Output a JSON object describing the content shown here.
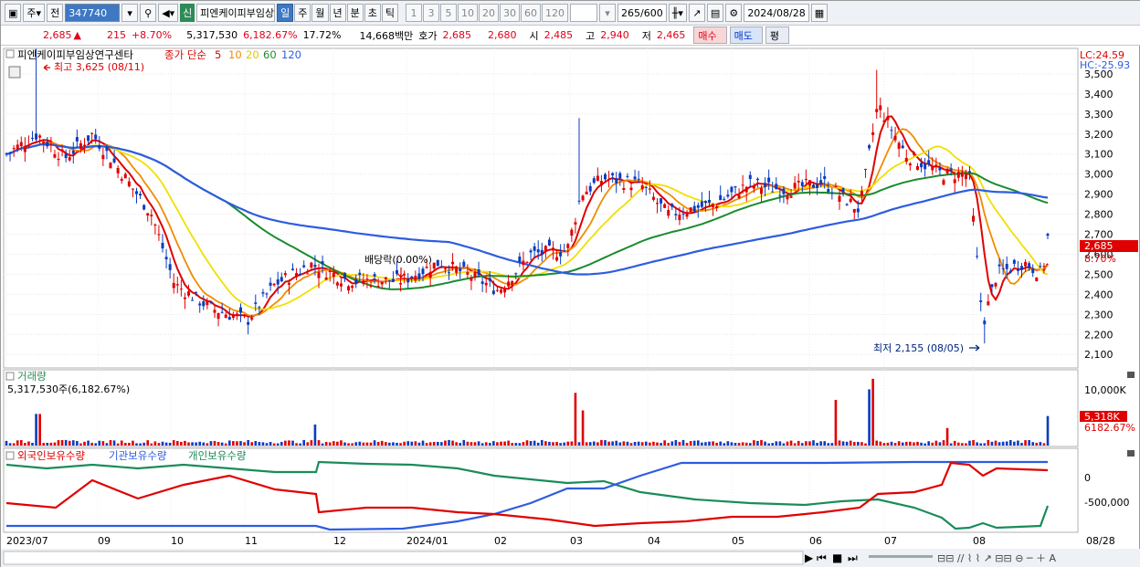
{
  "toolbar": {
    "mode": "주",
    "prev_label": "전",
    "code": "347740",
    "sin_badge": "신",
    "stock_name": "피엔케이피부임상연구센타",
    "periods": [
      "일",
      "주",
      "월",
      "년",
      "분",
      "초",
      "틱"
    ],
    "active_period": "일",
    "intervals": [
      "1",
      "3",
      "5",
      "10",
      "20",
      "30",
      "60",
      "120"
    ],
    "count": "265",
    "count_max": "/600",
    "date": "2024/08/28"
  },
  "quote": {
    "price": "2,685",
    "arrow": "▲",
    "change": "215",
    "change_pct": "+8.70%",
    "volume": "5,317,530",
    "vol_ratio": "6,182.67%",
    "turnover": "17.72%",
    "amount": "14,668백만",
    "ask_label": "호가",
    "ask": "2,685",
    "bid": "2,680",
    "open_label": "시",
    "open": "2,485",
    "high_label": "고",
    "high": "2,940",
    "low_label": "저",
    "low": "2,465",
    "buy_label": "매수",
    "sell_label": "매도",
    "eval_label": "평"
  },
  "price_panel": {
    "title": "피엔케이피부임상연구센타",
    "ma_prefix": "종가 단순",
    "ma_periods": [
      "5",
      "10",
      "20",
      "60",
      "120"
    ],
    "ma_colors": [
      "#e00000",
      "#f08c00",
      "#f0e000",
      "#1a8c2e",
      "#2e5ce0"
    ],
    "lc": "LC:24.59",
    "hc": "HC:-25.93",
    "max_label": "최고 3,625 (08/11)",
    "min_label": "최저 2,155 (08/05)",
    "dividend_label": "배당락(0.00%)",
    "last_price_tag": "2,685",
    "last_pct_tag": "8.70%"
  },
  "volume_panel": {
    "title": "거래량",
    "value": "5,317,530주(6,182.67%)",
    "axis_label": "10,000K",
    "tag1": "5,318K",
    "tag2": "6182.67%"
  },
  "holding_panel": {
    "legend": [
      {
        "label": "외국인보유수량",
        "color": "#e00000"
      },
      {
        "label": "기관보유수량",
        "color": "#2e5ce0"
      },
      {
        "label": "개인보유수량",
        "color": "#1a8c5a"
      }
    ],
    "y_ticks": [
      "0",
      "-500,000"
    ]
  },
  "x_ticks": [
    "2023/07",
    "09",
    "10",
    "11",
    "12",
    "2024/01",
    "02",
    "03",
    "04",
    "05",
    "06",
    "07",
    "08",
    "08/28"
  ],
  "chart_data": {
    "type": "candlestick",
    "period": "daily",
    "y_ticks": [
      2100,
      2200,
      2300,
      2400,
      2500,
      2600,
      2700,
      2800,
      2900,
      3000,
      3100,
      3200,
      3300,
      3400,
      3500
    ],
    "ylim": [
      2060,
      3600
    ],
    "price_anchors_by_month": [
      {
        "x": "2023/07",
        "close": 3100
      },
      {
        "x": "08",
        "close": 3150
      },
      {
        "x": "09",
        "close": 3080
      },
      {
        "x": "10",
        "close": 2600
      },
      {
        "x": "11",
        "close": 2300
      },
      {
        "x": "12",
        "close": 2520
      },
      {
        "x": "2024/01",
        "close": 2500
      },
      {
        "x": "02",
        "close": 2500
      },
      {
        "x": "03",
        "close": 2650
      },
      {
        "x": "04",
        "close": 2950
      },
      {
        "x": "05",
        "close": 2950
      },
      {
        "x": "06",
        "close": 2900
      },
      {
        "x": "07",
        "close": 3050
      },
      {
        "x": "08",
        "close": 2400
      },
      {
        "x": "08/28",
        "close": 2685
      }
    ],
    "annotations": {
      "high": 3625,
      "low": 2155,
      "last": 2685
    }
  }
}
